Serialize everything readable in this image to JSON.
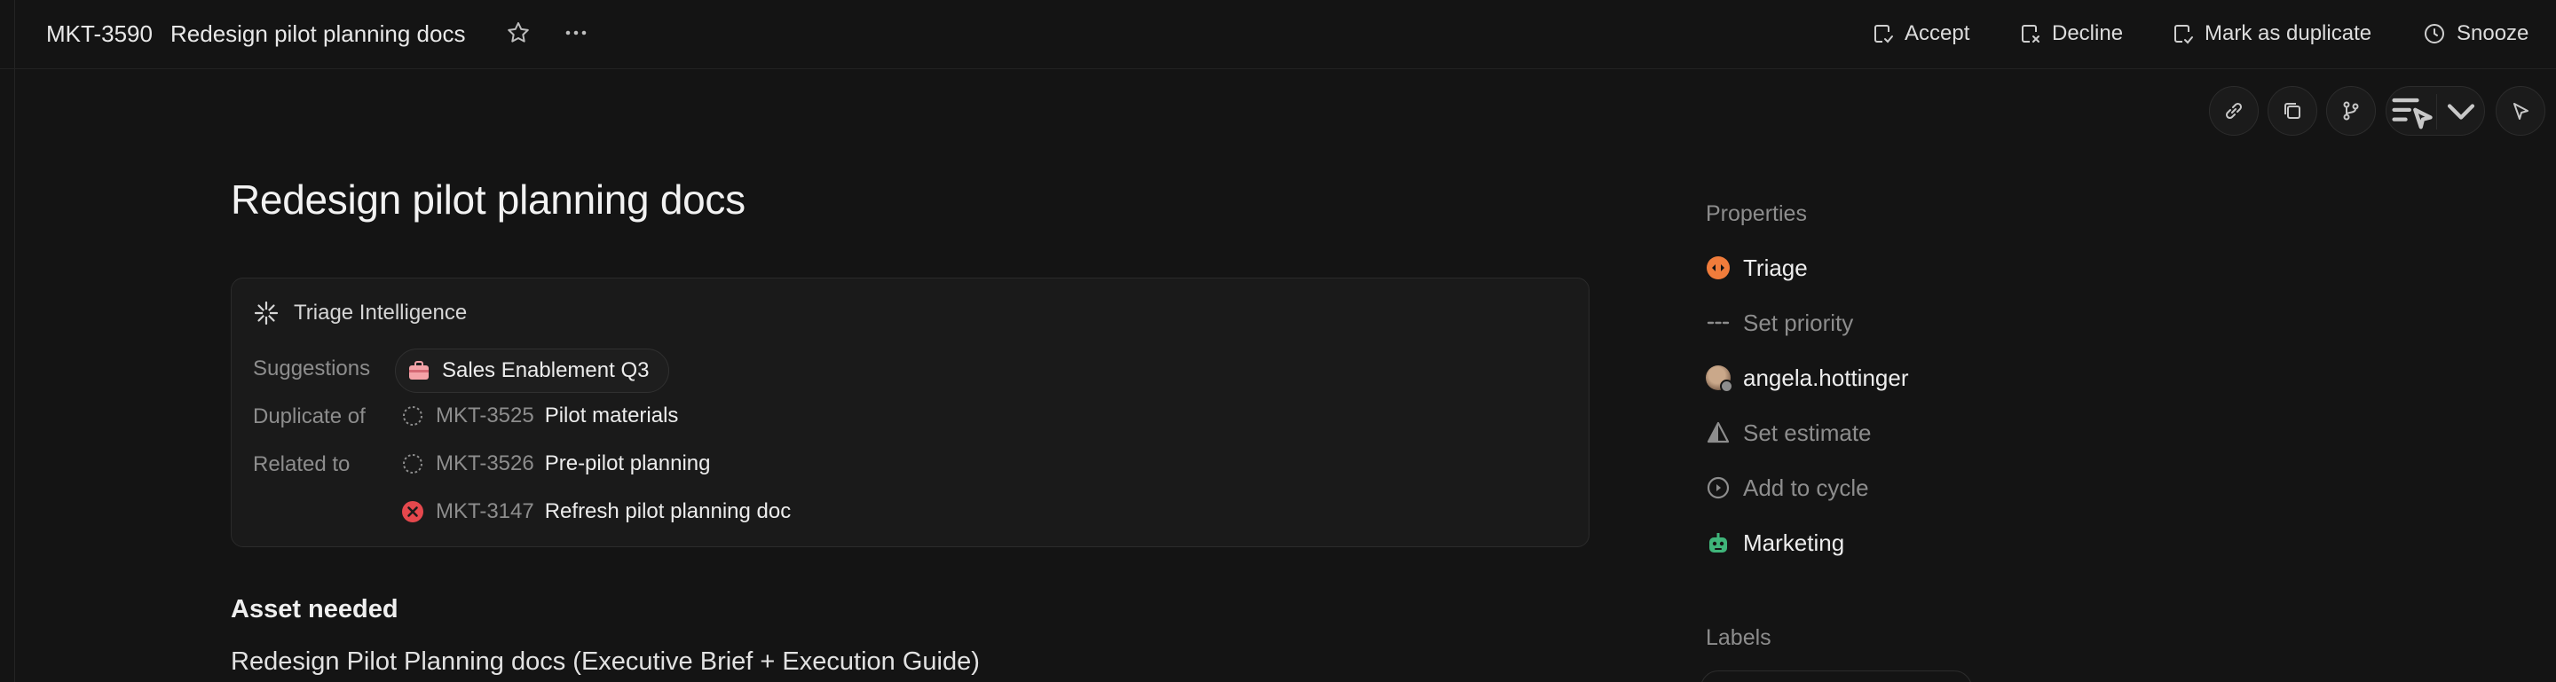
{
  "header": {
    "issue_id": "MKT-3590",
    "issue_title": "Redesign pilot planning docs",
    "actions": {
      "accept": "Accept",
      "decline": "Decline",
      "duplicate": "Mark as duplicate",
      "snooze": "Snooze"
    }
  },
  "toolbar": {
    "icons": [
      "link-icon",
      "copy-icon",
      "branch-icon",
      "agent-icon",
      "chevron-down-icon",
      "send-icon"
    ]
  },
  "main": {
    "title": "Redesign pilot planning docs",
    "triage": {
      "heading": "Triage Intelligence",
      "suggestions_label": "Suggestions",
      "suggestion": "Sales Enablement Q3",
      "duplicate_label": "Duplicate of",
      "related_label": "Related to",
      "duplicate": {
        "id": "MKT-3525",
        "title": "Pilot materials"
      },
      "related": [
        {
          "id": "MKT-3526",
          "title": "Pre-pilot planning",
          "status": "backlog"
        },
        {
          "id": "MKT-3147",
          "title": "Refresh pilot planning doc",
          "status": "canceled"
        }
      ]
    },
    "section_heading": "Asset needed",
    "body_text": "Redesign Pilot Planning docs (Executive Brief + Execution Guide)"
  },
  "properties": {
    "heading": "Properties",
    "status": "Triage",
    "priority": "Set priority",
    "assignee": "angela.hottinger",
    "estimate": "Set estimate",
    "cycle": "Add to cycle",
    "team": "Marketing",
    "labels_heading": "Labels"
  },
  "colors": {
    "triage": "#f07c3b",
    "canceled": "#e5484d",
    "team": "#3fb57a",
    "background": "#141414"
  }
}
